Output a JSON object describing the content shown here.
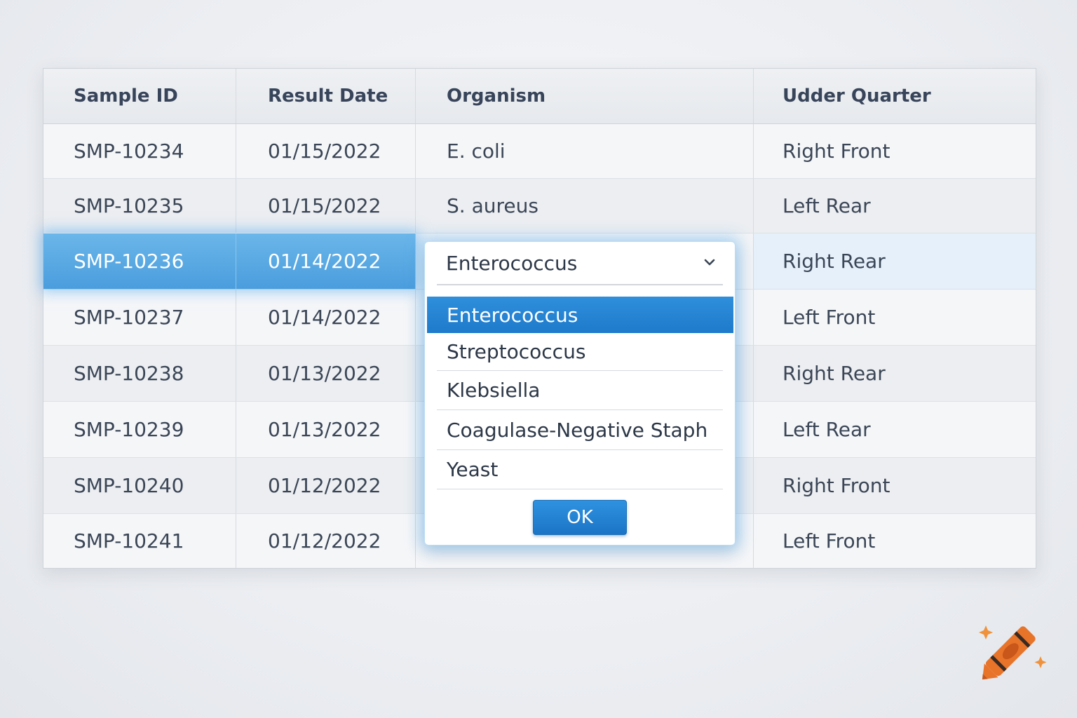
{
  "columns": [
    "Sample ID",
    "Result Date",
    "Organism",
    "Udder Quarter"
  ],
  "rows": [
    {
      "id": "SMP-10234",
      "date": "01/15/2022",
      "organism": "E. coli",
      "quarter": "Right Front"
    },
    {
      "id": "SMP-10235",
      "date": "01/15/2022",
      "organism": "S. aureus",
      "quarter": "Left Rear"
    },
    {
      "id": "SMP-10236",
      "date": "01/14/2022",
      "organism": "",
      "quarter": "Right Rear"
    },
    {
      "id": "SMP-10237",
      "date": "01/14/2022",
      "organism": "",
      "quarter": "Left Front"
    },
    {
      "id": "SMP-10238",
      "date": "01/13/2022",
      "organism": "",
      "quarter": "Right Rear"
    },
    {
      "id": "SMP-10239",
      "date": "01/13/2022",
      "organism": "",
      "quarter": "Left Rear"
    },
    {
      "id": "SMP-10240",
      "date": "01/12/2022",
      "organism": "",
      "quarter": "Right Front"
    },
    {
      "id": "SMP-10241",
      "date": "01/12/2022",
      "organism": "",
      "quarter": "Left Front"
    }
  ],
  "dropdown": {
    "value": "Enterococcus",
    "options": [
      "Enterococcus",
      "Streptococcus",
      "Klebsiella",
      "Coagulase-Negative Staph",
      "Yeast"
    ],
    "ok_label": "OK"
  },
  "icons": {
    "dropdown": "chevron-down-icon",
    "brand": "crayon-logo-icon"
  },
  "colors": {
    "selection": "#4a9ddd",
    "accent": "#1e7acb",
    "logo": "#e8742a"
  }
}
